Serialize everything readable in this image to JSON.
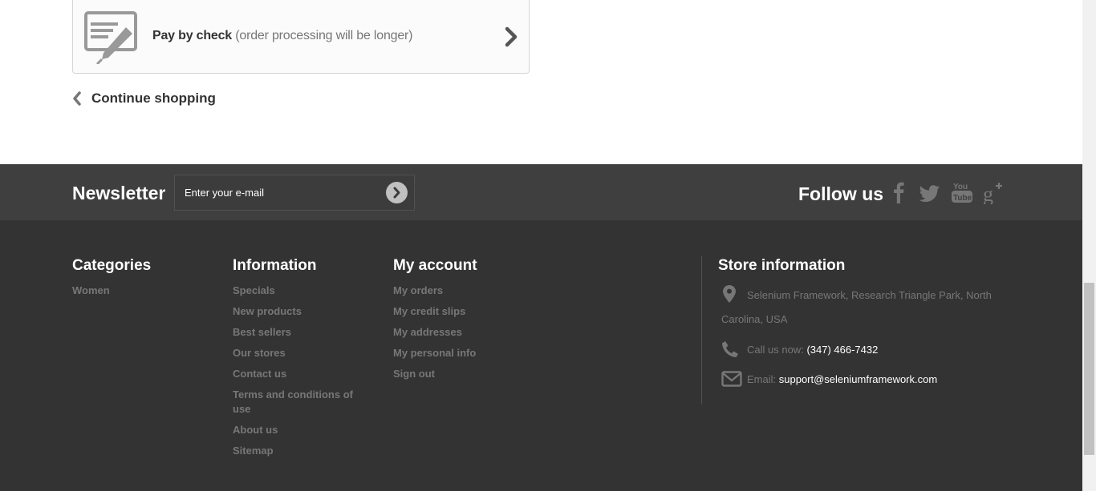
{
  "payment": {
    "method_label": "Pay by check",
    "method_note": "(order processing will be longer)",
    "icon": "check-pen-icon",
    "arrow_icon": "chevron-right-icon"
  },
  "continue_shopping": {
    "label": "Continue shopping",
    "icon": "chevron-left-icon"
  },
  "newsletter": {
    "title": "Newsletter",
    "placeholder": "Enter your e-mail",
    "submit_icon": "arrow-circle-right-icon"
  },
  "follow": {
    "title": "Follow us",
    "networks": [
      "facebook-icon",
      "twitter-icon",
      "youtube-icon",
      "google-plus-icon"
    ]
  },
  "footer": {
    "categories": {
      "title": "Categories",
      "items": [
        "Women"
      ]
    },
    "information": {
      "title": "Information",
      "items": [
        "Specials",
        "New products",
        "Best sellers",
        "Our stores",
        "Contact us",
        "Terms and conditions of use",
        "About us",
        "Sitemap"
      ]
    },
    "account": {
      "title": "My account",
      "items": [
        "My orders",
        "My credit slips",
        "My addresses",
        "My personal info",
        "Sign out"
      ]
    },
    "store": {
      "title": "Store information",
      "address_line1": "Selenium Framework, Research Triangle Park, North",
      "address_line2": "Carolina, USA",
      "call_label": "Call us now:",
      "phone": "(347) 466-7432",
      "email_label": "Email:",
      "email": "support@seleniumframework.com"
    }
  },
  "colors": {
    "newsletter_bg": "#3f3f3f",
    "footer_bg": "#333333",
    "link_muted": "#777777",
    "heading": "#ffffff"
  }
}
